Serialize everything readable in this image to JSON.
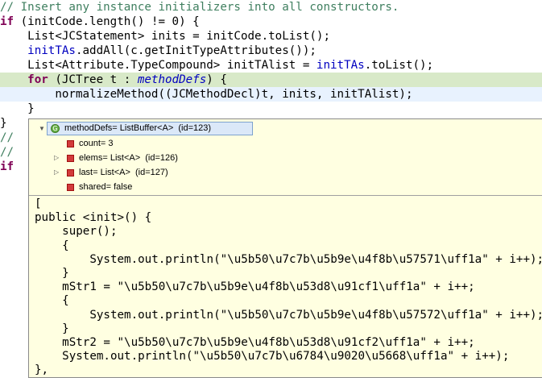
{
  "editor": {
    "lines": [
      {
        "segments": [
          {
            "t": "// Insert any instance initializers into all constructors.",
            "c": "cm"
          }
        ]
      },
      {
        "segments": [
          {
            "t": "if",
            "c": "kw"
          },
          {
            "t": " (initCode.length() != 0) {"
          }
        ]
      },
      {
        "segments": [
          {
            "t": "    List<JCStatement> inits = initCode.toList();"
          }
        ]
      },
      {
        "segments": [
          {
            "t": "    initTAs",
            "c": "fld"
          },
          {
            "t": ".addAll(c.getInitTypeAttributes());"
          }
        ]
      },
      {
        "segments": [
          {
            "t": "    List<Attribute.TypeCompound> initTAlist = "
          },
          {
            "t": "initTAs",
            "c": "fld"
          },
          {
            "t": ".toList();"
          }
        ]
      },
      {
        "segments": [
          {
            "t": "    "
          },
          {
            "t": "for",
            "c": "kw"
          },
          {
            "t": " (JCTree t : "
          },
          {
            "t": "methodDefs",
            "c": "fld it"
          },
          {
            "t": ") {"
          }
        ]
      },
      {
        "segments": [
          {
            "t": "        normalizeMethod((JCMethodDecl)t, inits, initTAlist);"
          }
        ]
      },
      {
        "segments": [
          {
            "t": "    }"
          }
        ]
      },
      {
        "segments": [
          {
            "t": "}"
          }
        ]
      },
      {
        "segments": [
          {
            "t": "//",
            "c": "cm"
          }
        ]
      },
      {
        "segments": [
          {
            "t": "//",
            "c": "cm"
          }
        ]
      },
      {
        "segments": [
          {
            "t": "if",
            "c": "kw"
          }
        ]
      }
    ]
  },
  "hover": {
    "root_label": "methodDefs= ListBuffer<A>  (id=123)",
    "children": [
      {
        "label": "count= 3",
        "expandable": false
      },
      {
        "label": "elems= List<A>  (id=126)",
        "expandable": true
      },
      {
        "label": "last= List<A>  (id=127)",
        "expandable": true
      },
      {
        "label": "shared= false",
        "expandable": false
      }
    ],
    "detail_lines": [
      "[",
      "public <init>() {",
      "    super();",
      "    {",
      "        System.out.println(\"\\u5b50\\u7c7b\\u5b9e\\u4f8b\\u57571\\uff1a\" + i++);",
      "    }",
      "    mStr1 = \"\\u5b50\\u7c7b\\u5b9e\\u4f8b\\u53d8\\u91cf1\\uff1a\" + i++;",
      "    {",
      "        System.out.println(\"\\u5b50\\u7c7b\\u5b9e\\u4f8b\\u57572\\uff1a\" + i++);",
      "    }",
      "    mStr2 = \"\\u5b50\\u7c7b\\u5b9e\\u4f8b\\u53d8\\u91cf2\\uff1a\" + i++;",
      "    System.out.println(\"\\u5b50\\u7c7b\\u6784\\u9020\\u5668\\uff1a\" + i++);",
      "},"
    ]
  },
  "colors": {
    "keyword": "#7f0055",
    "comment": "#3f7f5f",
    "field": "#0000c0",
    "current_line": "#d8e9c8",
    "hover_bg": "#ffffe1"
  },
  "icons": {
    "root": "object-variable-icon",
    "field": "field-icon",
    "expand": "expand-triangle-icon"
  }
}
